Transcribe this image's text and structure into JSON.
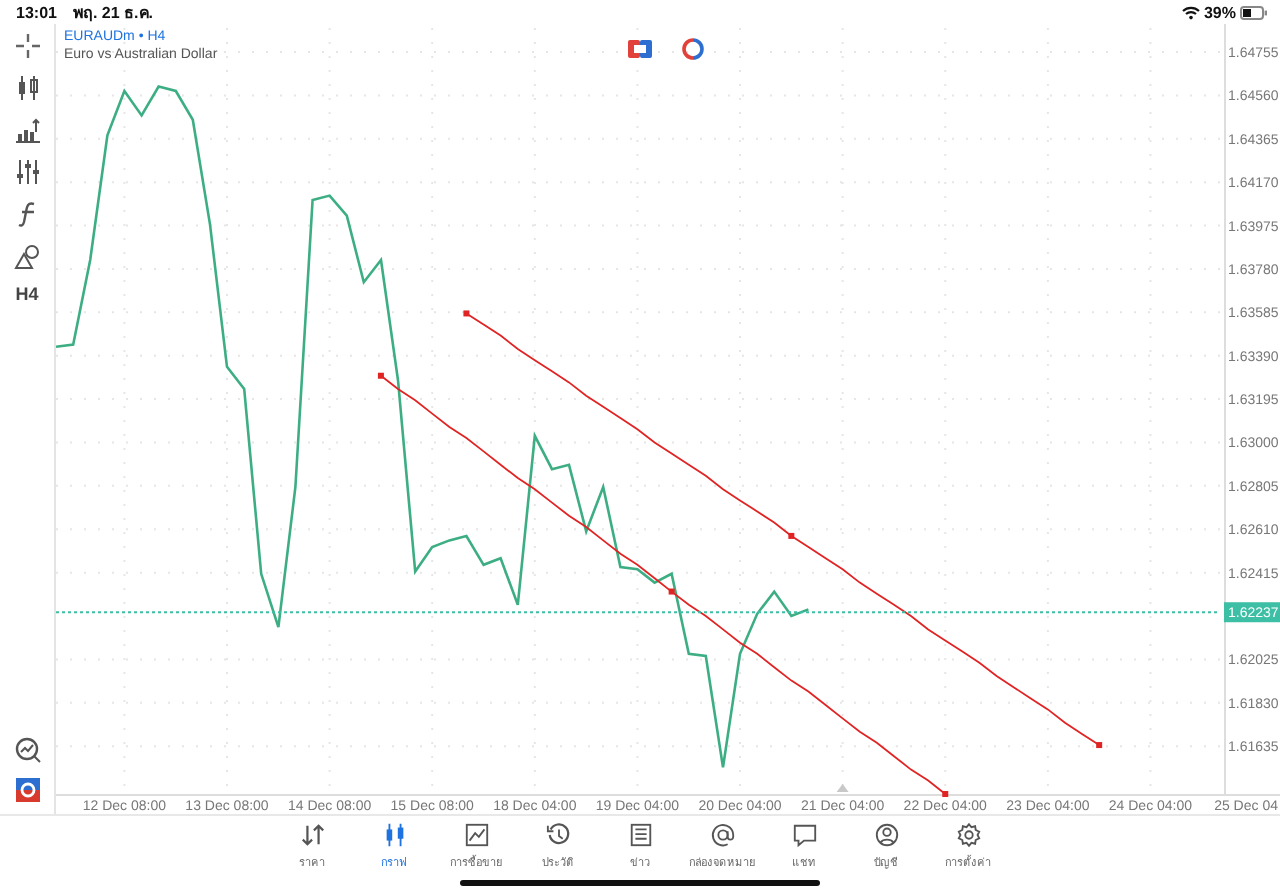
{
  "status_bar": {
    "time": "13:01",
    "date": "พฤ. 21 ธ.ค.",
    "battery": "39%"
  },
  "toolbar": {
    "timeframe": "H4"
  },
  "chart": {
    "separator": "•",
    "timeframe": "H4",
    "description": "Euro vs Australian Dollar",
    "chart_data": {
      "type": "line",
      "grid": true,
      "categories": [
        null,
        null,
        null,
        null,
        "12 Dec 08:00",
        null,
        null,
        null,
        null,
        null,
        "13 Dec 08:00",
        null,
        null,
        null,
        null,
        null,
        "14 Dec 08:00",
        null,
        null,
        null,
        null,
        null,
        "15 Dec 08:00",
        null,
        null,
        null,
        null,
        null,
        "18 Dec 04:00",
        null,
        null,
        null,
        null,
        null,
        "19 Dec 04:00",
        null,
        null,
        null,
        null,
        null,
        "20 Dec 04:00",
        null,
        null,
        null,
        null,
        null,
        "21 Dec 04:00",
        null,
        null,
        null,
        null,
        null,
        "22 Dec 04:00",
        null,
        null,
        null,
        null,
        null,
        "23 Dec 04:00",
        null,
        null,
        null,
        null,
        null,
        "24 Dec 04:00",
        null,
        null,
        null,
        null
      ],
      "series": [
        {
          "name": "EURAUDm",
          "color": "#3dae84",
          "values": [
            1.6343,
            1.6344,
            1.6382,
            1.6438,
            1.6458,
            1.6447,
            1.646,
            1.6458,
            1.6445,
            1.6398,
            1.6334,
            1.6324,
            1.6241,
            1.6217,
            1.628,
            1.6409,
            1.6411,
            1.6402,
            1.6372,
            1.6382,
            1.6328,
            1.6242,
            1.6253,
            1.6256,
            1.6258,
            1.6245,
            1.6248,
            1.6227,
            1.6303,
            1.6288,
            1.629,
            1.626,
            1.628,
            1.6244,
            1.6243,
            1.6237,
            1.6241,
            1.6205,
            1.6204,
            1.6154,
            1.6205,
            1.6223,
            1.6233,
            1.6222,
            1.6225,
            null,
            null,
            null,
            null,
            null,
            null,
            null,
            null,
            null,
            null,
            null,
            null,
            null,
            null,
            null,
            null,
            null,
            null,
            null,
            null,
            null,
            null,
            null,
            null
          ]
        },
        {
          "color": "#e02424",
          "values": [
            null,
            null,
            null,
            null,
            null,
            null,
            null,
            null,
            null,
            null,
            null,
            null,
            null,
            null,
            null,
            null,
            null,
            null,
            null,
            1.633,
            1.6324,
            1.6319,
            1.6313,
            1.6307,
            1.6302,
            1.6296,
            1.629,
            1.6284,
            1.6279,
            1.6273,
            1.6267,
            1.6262,
            1.6256,
            1.625,
            1.6245,
            1.6239,
            1.6233,
            1.6227,
            1.6222,
            1.6216,
            1.621,
            1.6205,
            1.6199,
            1.6193,
            1.6188,
            1.6182,
            1.6176,
            1.617,
            1.6165,
            1.6159,
            1.6153,
            1.6148,
            1.6142,
            null,
            null,
            null,
            null,
            null,
            null,
            null,
            null,
            null,
            null,
            null,
            null,
            null,
            null,
            null,
            null
          ]
        },
        {
          "color": "#e02424",
          "values": [
            null,
            null,
            null,
            null,
            null,
            null,
            null,
            null,
            null,
            null,
            null,
            null,
            null,
            null,
            null,
            null,
            null,
            null,
            null,
            null,
            null,
            null,
            null,
            null,
            1.6358,
            1.6353,
            1.6348,
            1.6342,
            1.6337,
            1.6332,
            1.6327,
            1.6321,
            1.6316,
            1.6311,
            1.6306,
            1.63,
            1.6295,
            1.629,
            1.6285,
            1.6279,
            1.6274,
            1.6269,
            1.6264,
            1.6258,
            1.6253,
            1.6248,
            1.6243,
            1.6237,
            1.6232,
            1.6227,
            1.6222,
            1.6216,
            1.6211,
            1.6206,
            1.6201,
            1.6195,
            1.619,
            1.6185,
            1.618,
            1.6174,
            1.6169,
            1.6164,
            null,
            null,
            null,
            null,
            null,
            null,
            null
          ]
        },
        {
          "color": "#3dbfa5",
          "line_style": "dotted",
          "values": [
            1.62237,
            1.62237,
            1.62237,
            1.62237,
            1.62237,
            1.62237,
            1.62237,
            1.62237,
            1.62237,
            1.62237,
            1.62237,
            1.62237,
            1.62237,
            1.62237,
            1.62237,
            1.62237,
            1.62237,
            1.62237,
            1.62237,
            1.62237,
            1.62237,
            1.62237,
            1.62237,
            1.62237,
            1.62237,
            1.62237,
            1.62237,
            1.62237,
            1.62237,
            1.62237,
            1.62237,
            1.62237,
            1.62237,
            1.62237,
            1.62237,
            1.62237,
            1.62237,
            1.62237,
            1.62237,
            1.62237,
            1.62237,
            1.62237,
            1.62237,
            1.62237,
            1.62237,
            1.62237,
            1.62237,
            1.62237,
            1.62237,
            1.62237,
            1.62237,
            1.62237,
            1.62237,
            1.62237,
            1.62237,
            1.62237,
            1.62237,
            1.62237,
            1.62237,
            1.62237,
            1.62237,
            1.62237,
            1.62237,
            1.62237,
            1.62237,
            1.62237,
            1.62237,
            1.62237,
            1.62237
          ]
        }
      ],
      "ylim": [
        1.6142,
        1.64863
      ],
      "yticks": [
        {
          "value": 1.64755,
          "label": "1.64755"
        },
        {
          "value": 1.6456,
          "label": "1.64560"
        },
        {
          "value": 1.64365,
          "label": "1.64365"
        },
        {
          "value": 1.6417,
          "label": "1.64170"
        },
        {
          "value": 1.63975,
          "label": "1.63975"
        },
        {
          "value": 1.6378,
          "label": "1.63780"
        },
        {
          "value": 1.63585,
          "label": "1.63585"
        },
        {
          "value": 1.6339,
          "label": "1.63390"
        },
        {
          "value": 1.63195,
          "label": "1.63195"
        },
        {
          "value": 1.63,
          "label": "1.63000"
        },
        {
          "value": 1.62805,
          "label": "1.62805"
        },
        {
          "value": 1.6261,
          "label": "1.62610"
        },
        {
          "value": 1.62415,
          "label": "1.62415"
        },
        {
          "value": 1.62025,
          "label": "1.62025"
        },
        {
          "value": 1.6183,
          "label": "1.61830"
        },
        {
          "value": 1.61635,
          "label": "1.61635"
        }
      ]
    },
    "x_axis_edge_label": "25 Dec 04",
    "current_price": "1.62237"
  },
  "nav": [
    {
      "label": "ราคา",
      "selected": false
    },
    {
      "label": "กราฟ",
      "selected": true
    },
    {
      "label": "การซื้อขาย",
      "selected": false
    },
    {
      "label": "ประวัติ",
      "selected": false
    },
    {
      "label": "ข่าว",
      "selected": false
    },
    {
      "label": "กล่องจดหมาย",
      "selected": false
    },
    {
      "label": "แชท",
      "selected": false
    },
    {
      "label": "บัญชี",
      "selected": false
    },
    {
      "label": "การตั้งค่า",
      "selected": false
    }
  ]
}
